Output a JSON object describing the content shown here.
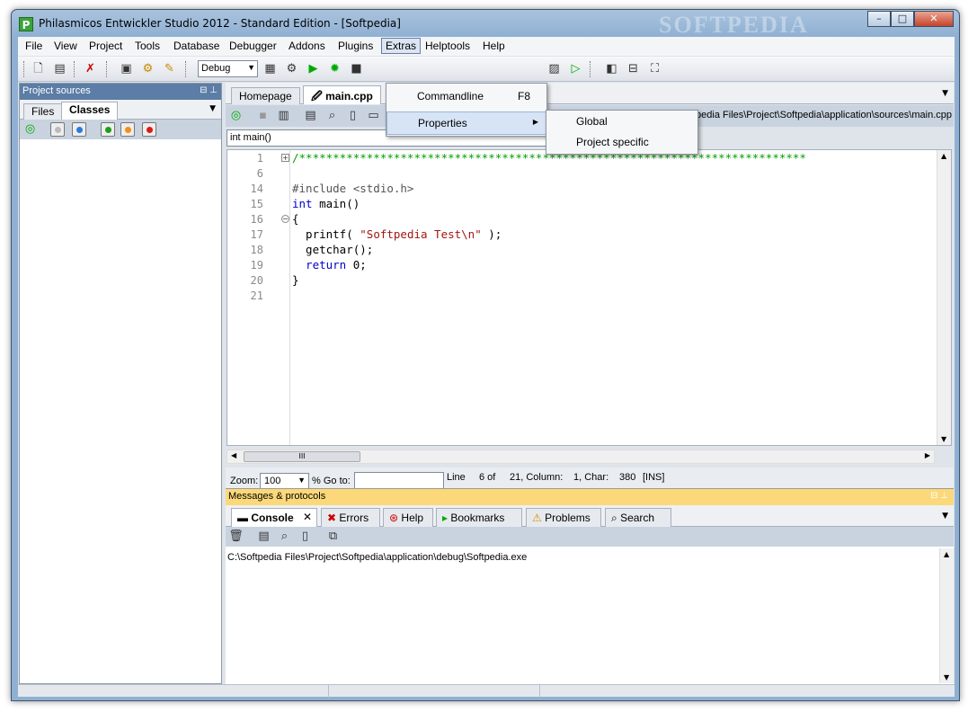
{
  "window": {
    "title": "Philasmicos Entwickler Studio 2012 - Standard Edition - [Softpedia]",
    "watermark": "SOFTPEDIA",
    "app_icon_letter": "P",
    "controls": {
      "minimize": "–",
      "maximize": "□",
      "close": "✕"
    }
  },
  "menubar": {
    "items": [
      "File",
      "View",
      "Project",
      "Tools",
      "Database",
      "Debugger",
      "Addons",
      "Plugins",
      "Extras",
      "Helptools",
      "Help"
    ],
    "active": "Extras"
  },
  "toolbar": {
    "config_select": "Debug"
  },
  "extras_menu": {
    "items": [
      {
        "label": "Commandline",
        "shortcut": "F8"
      },
      {
        "label": "Properties",
        "has_submenu": true
      }
    ],
    "properties_submenu": [
      "Global",
      "Project specific"
    ]
  },
  "left_panel": {
    "title": "Project sources",
    "tabs": [
      "Files",
      "Classes"
    ],
    "active_tab": "Classes"
  },
  "editor": {
    "tabs": [
      "Homepage",
      "main.cpp"
    ],
    "active_tab": "main.cpp",
    "file_path": "oftpedia Files\\Project\\Softpedia\\application\\sources\\main.cpp",
    "function_select": "int main()",
    "line_numbers": [
      "1",
      "6",
      "14",
      "15",
      "16",
      "17",
      "18",
      "19",
      "20",
      "21"
    ],
    "code": {
      "comment_line": "/***************************************************************************",
      "include": "#include <stdio.h>",
      "kw_int": "int",
      "main_sig": " main()",
      "brace_open": "{",
      "printf_start": "  printf( ",
      "printf_str": "\"Softpedia Test\\n\"",
      "printf_end": " );",
      "getchar": "  getchar();",
      "kw_return": "  return",
      "return_val": " 0;",
      "brace_close": "}"
    },
    "hscroll_thumb": "III"
  },
  "status_row": {
    "zoom_label": "Zoom:",
    "zoom_value": "100",
    "goto_label": "% Go to:",
    "line_label": "Line",
    "line_value": "6 of",
    "line_total": "21, Column:",
    "column_value": "1, Char:",
    "char_value": "380",
    "mode": "[INS]"
  },
  "messages_panel": {
    "title": "Messages & protocols",
    "tabs": [
      "Console",
      "Errors",
      "Help",
      "Bookmarks",
      "Problems",
      "Search"
    ],
    "active_tab": "Console",
    "console_output": "C:\\Softpedia Files\\Project\\Softpedia\\application\\debug\\Softpedia.exe"
  },
  "colors": {
    "accent": "#5b7da6",
    "messages_header": "#fbd97a",
    "comment": "#00a000",
    "keyword": "#0000cc",
    "string": "#a31515"
  }
}
